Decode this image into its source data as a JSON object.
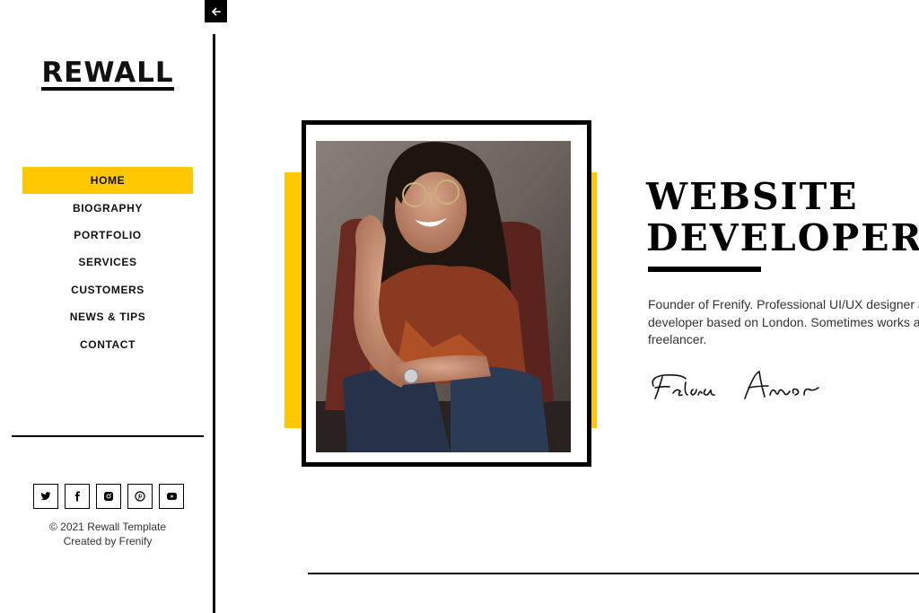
{
  "brand": {
    "logo_text": "REWALL"
  },
  "sidebar": {
    "toggle_icon": "arrow-left-icon",
    "nav": [
      {
        "label": "HOME",
        "active": true
      },
      {
        "label": "BIOGRAPHY",
        "active": false
      },
      {
        "label": "PORTFOLIO",
        "active": false
      },
      {
        "label": "SERVICES",
        "active": false
      },
      {
        "label": "CUSTOMERS",
        "active": false
      },
      {
        "label": "NEWS & TIPS",
        "active": false
      },
      {
        "label": "CONTACT",
        "active": false
      }
    ],
    "socials": [
      "twitter-icon",
      "facebook-icon",
      "instagram-icon",
      "pinterest-icon",
      "youtube-icon"
    ],
    "copyright": "© 2021 Rewall Template",
    "credit": "Created by Frenify"
  },
  "hero": {
    "title_line1": "WEBSITE",
    "title_line2": "DEVELOPER",
    "bio_line1": "Founder of Frenify. Professional UI/UX designer and",
    "bio_line2": "developer based on London. Sometimes works as",
    "bio_line3": "freelancer.",
    "signature": "Felicia Amor"
  },
  "colors": {
    "accent": "#ffc800",
    "ink": "#000000"
  }
}
